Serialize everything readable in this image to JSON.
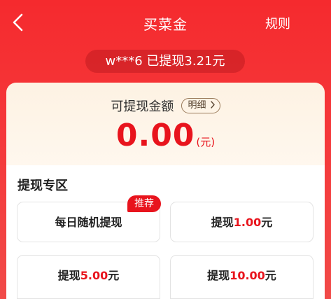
{
  "header": {
    "back_icon": "chevron-left-icon",
    "title": "买菜金",
    "rules_label": "规则"
  },
  "notice": {
    "text": "w***6 已提现3.21元"
  },
  "balance": {
    "label": "可提现金额",
    "detail_label": "明细",
    "detail_icon": "chevron-right-icon",
    "amount": "0.00",
    "unit": "(元)"
  },
  "withdraw": {
    "section_title": "提现专区",
    "options": [
      {
        "label": "每日随机提现",
        "amount": "",
        "unit": ""
      },
      {
        "label": "提现",
        "amount": "1.00",
        "unit": "元"
      },
      {
        "label": "提现",
        "amount": "5.00",
        "unit": "元"
      },
      {
        "label": "提现",
        "amount": "10.00",
        "unit": "元"
      }
    ],
    "badge": "推荐"
  },
  "colors": {
    "header_red": "#f52a2e",
    "accent_red": "#e8141d",
    "card_cream": "#fdf2e3"
  }
}
